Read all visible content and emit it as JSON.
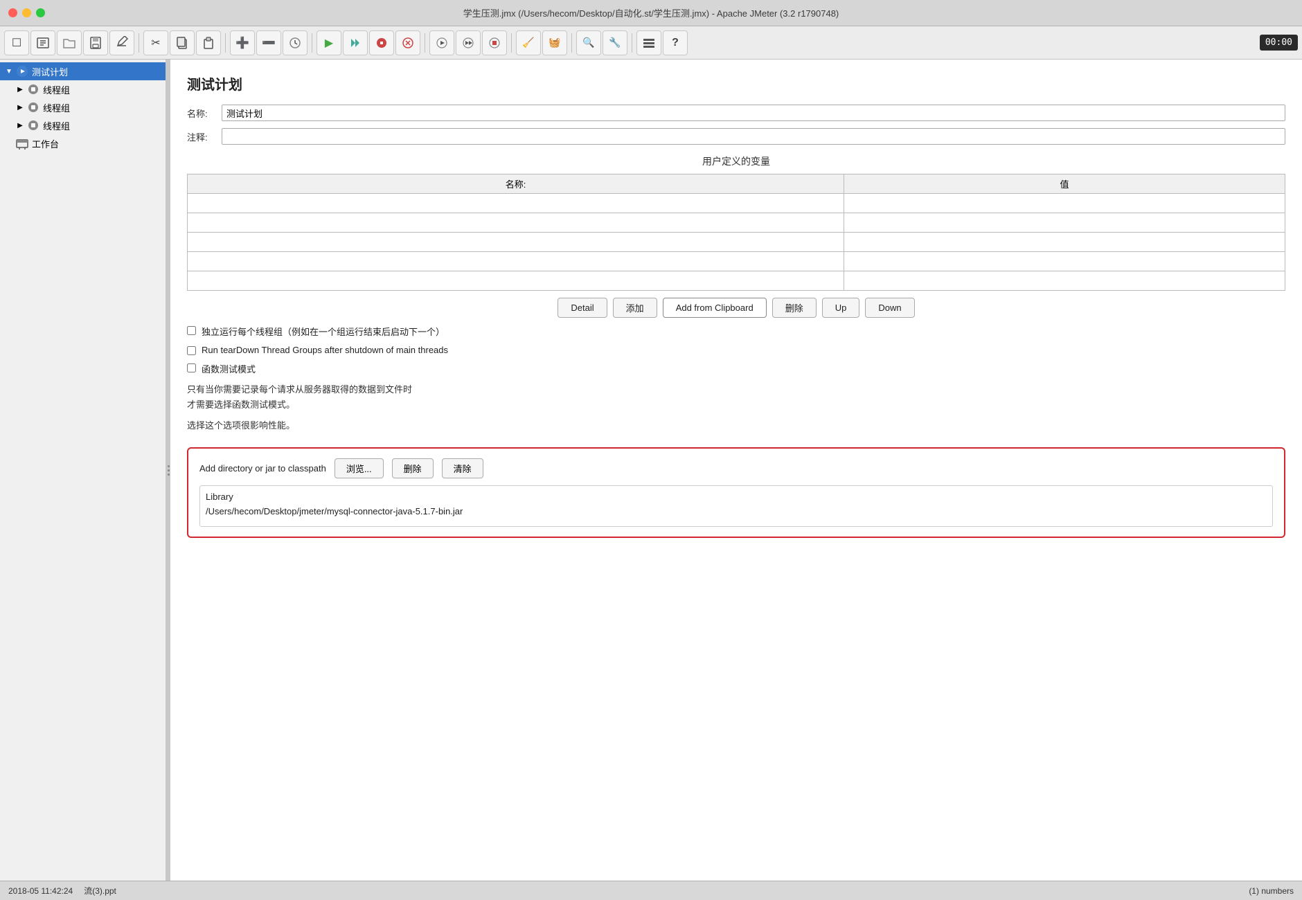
{
  "titleBar": {
    "title": "学生压测.jmx (/Users/hecom/Desktop/自动化.st/学生压测.jmx) - Apache JMeter (3.2 r1790748)"
  },
  "toolbar": {
    "buttons": [
      {
        "name": "new-button",
        "icon": "☐",
        "label": "新建"
      },
      {
        "name": "open-templates-button",
        "icon": "📋",
        "label": "模板"
      },
      {
        "name": "open-button",
        "icon": "📁",
        "label": "打开"
      },
      {
        "name": "save-button",
        "icon": "💾",
        "label": "保存"
      },
      {
        "name": "edit-button",
        "icon": "✏️",
        "label": "编辑"
      },
      {
        "name": "cut-button",
        "icon": "✂",
        "label": "剪切"
      },
      {
        "name": "copy-button",
        "icon": "📄",
        "label": "复制"
      },
      {
        "name": "paste-button",
        "icon": "📋",
        "label": "粘贴"
      },
      {
        "name": "expand-button",
        "icon": "➕",
        "label": "展开"
      },
      {
        "name": "collapse-button",
        "icon": "➖",
        "label": "折叠"
      },
      {
        "name": "toggle-button",
        "icon": "🔄",
        "label": "切换"
      },
      {
        "name": "run-button",
        "icon": "▶",
        "label": "运行"
      },
      {
        "name": "run-no-pause-button",
        "icon": "▶▶",
        "label": "无暂停运行"
      },
      {
        "name": "stop-button",
        "icon": "⏹",
        "label": "停止"
      },
      {
        "name": "shutdown-button",
        "icon": "✖",
        "label": "关闭"
      },
      {
        "name": "remote-run-button",
        "icon": "🔁",
        "label": "远程运行"
      },
      {
        "name": "remote-run-all-button",
        "icon": "⚙",
        "label": "全部远程运行"
      },
      {
        "name": "remote-stop-button",
        "icon": "⚙⚙",
        "label": "远程停止"
      },
      {
        "name": "clear-button",
        "icon": "🧹",
        "label": "清除"
      },
      {
        "name": "clear-all-button",
        "icon": "🧺",
        "label": "清除全部"
      },
      {
        "name": "search-button",
        "icon": "🔍",
        "label": "搜索"
      },
      {
        "name": "info-button",
        "icon": "🔧",
        "label": "信息"
      },
      {
        "name": "list-button",
        "icon": "☰",
        "label": "列表"
      },
      {
        "name": "help-button",
        "icon": "?",
        "label": "帮助"
      }
    ],
    "time": "00:00"
  },
  "sidebar": {
    "items": [
      {
        "id": "test-plan",
        "label": "测试计划",
        "level": 0,
        "selected": true,
        "expanded": true,
        "icon": "🔵",
        "hasToggle": true,
        "toggleOpen": true
      },
      {
        "id": "thread-group-1",
        "label": "线程组",
        "level": 1,
        "selected": false,
        "expanded": false,
        "icon": "⚙",
        "hasToggle": true,
        "toggleOpen": false
      },
      {
        "id": "thread-group-2",
        "label": "线程组",
        "level": 1,
        "selected": false,
        "expanded": false,
        "icon": "⚙",
        "hasToggle": true,
        "toggleOpen": false
      },
      {
        "id": "thread-group-3",
        "label": "线程组",
        "level": 1,
        "selected": false,
        "expanded": false,
        "icon": "⚙",
        "hasToggle": true,
        "toggleOpen": false
      },
      {
        "id": "workbench",
        "label": "工作台",
        "level": 0,
        "selected": false,
        "expanded": false,
        "icon": "🖥",
        "hasToggle": false
      }
    ]
  },
  "contentPanel": {
    "title": "测试计划",
    "nameLabel": "名称:",
    "nameValue": "测试计划",
    "commentLabel": "注释:",
    "commentValue": "",
    "variablesSection": {
      "title": "用户定义的变量",
      "columns": [
        {
          "label": "名称:"
        },
        {
          "label": "值"
        }
      ],
      "rows": []
    },
    "tableButtons": [
      {
        "name": "detail-button",
        "label": "Detail"
      },
      {
        "name": "add-button",
        "label": "添加"
      },
      {
        "name": "add-from-clipboard-button",
        "label": "Add from Clipboard"
      },
      {
        "name": "delete-button",
        "label": "删除"
      },
      {
        "name": "up-button",
        "label": "Up"
      },
      {
        "name": "down-button",
        "label": "Down"
      }
    ],
    "checkboxes": [
      {
        "name": "independent-run-checkbox",
        "label": "独立运行每个线程组（例如在一个组运行结束后启动下一个）",
        "checked": false
      },
      {
        "name": "teardown-checkbox",
        "label": "Run tearDown Thread Groups after shutdown of main threads",
        "checked": false
      },
      {
        "name": "functional-mode-checkbox",
        "label": "函数测试模式",
        "checked": false
      }
    ],
    "infoText1": "只有当你需要记录每个请求从服务器取得的数据到文件时",
    "infoText2": "才需要选择函数测试模式。",
    "infoText3": "选择这个选项很影响性能。",
    "classpathSection": {
      "title": "Add directory or jar to classpath",
      "buttons": [
        {
          "name": "browse-button",
          "label": "浏览..."
        },
        {
          "name": "classpath-delete-button",
          "label": "删除"
        },
        {
          "name": "clear-button",
          "label": "清除"
        }
      ],
      "listItems": [
        {
          "label": "Library"
        },
        {
          "label": "/Users/hecom/Desktop/jmeter/mysql-connector-java-5.1.7-bin.jar"
        }
      ]
    }
  },
  "statusBar": {
    "datetime": "2018-05  11:42:24",
    "filename": "流(3).ppt",
    "rightText": "(1) numbers"
  }
}
